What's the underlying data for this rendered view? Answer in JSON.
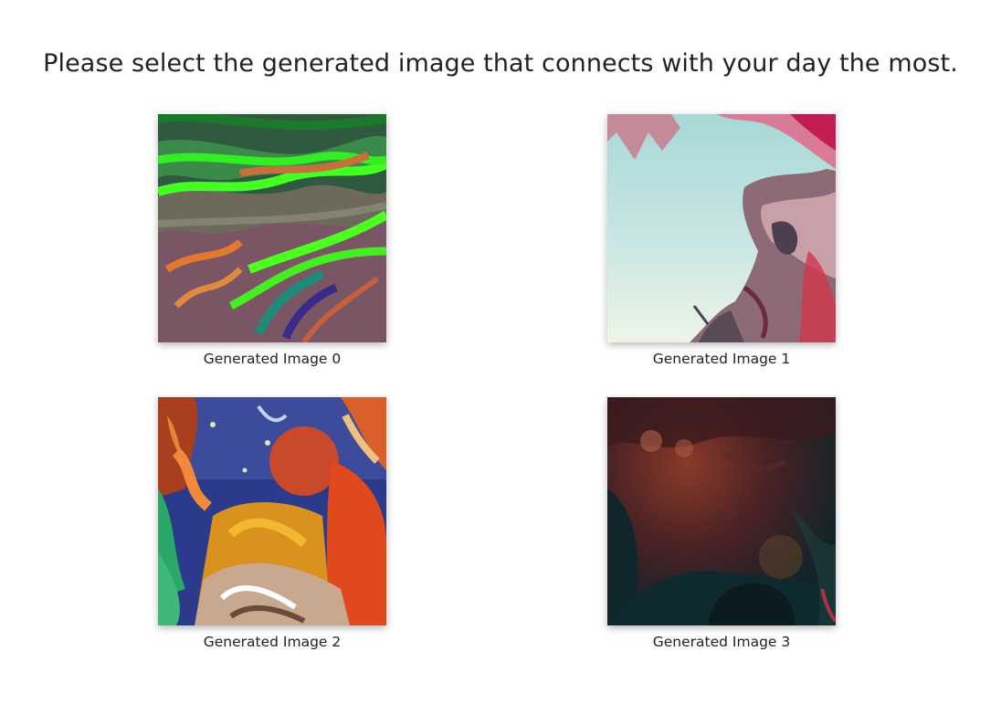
{
  "prompt": "Please select the generated image that connects with your day the most.",
  "images": [
    {
      "caption": "Generated Image 0"
    },
    {
      "caption": "Generated Image 1"
    },
    {
      "caption": "Generated Image 2"
    },
    {
      "caption": "Generated Image 3"
    }
  ]
}
